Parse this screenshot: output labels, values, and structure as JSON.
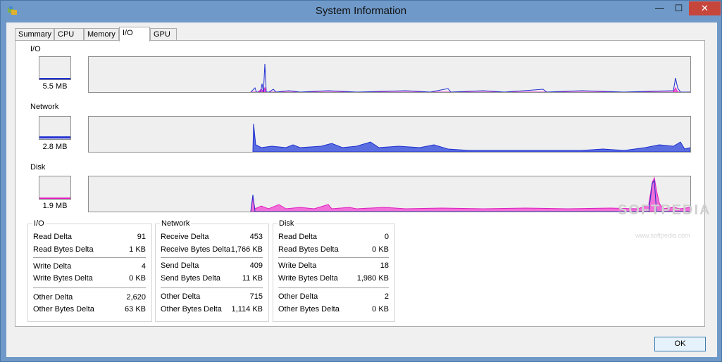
{
  "window": {
    "title": "System Information"
  },
  "controls": {
    "minimize": "—",
    "maximize": "☐",
    "close": "✕"
  },
  "tabs": [
    {
      "label": "Summary"
    },
    {
      "label": "CPU"
    },
    {
      "label": "Memory"
    },
    {
      "label": "I/O",
      "active": true
    },
    {
      "label": "GPU"
    }
  ],
  "graphs": {
    "io": {
      "label": "I/O",
      "value": "5.5  MB"
    },
    "network": {
      "label": "Network",
      "value": "2.8  MB"
    },
    "disk": {
      "label": "Disk",
      "value": "1.9  MB"
    }
  },
  "colors": {
    "blue": "#1f2fd0",
    "fill_blue": "#5a6ee0",
    "pink": "#e020c0",
    "fill_pink": "#f070d8"
  },
  "groups": {
    "io": {
      "title": "I/O",
      "rows": [
        {
          "label": "Read Delta",
          "value": "91"
        },
        {
          "label": "Read Bytes Delta",
          "value": "1 KB"
        },
        {
          "label": "Write Delta",
          "value": "4"
        },
        {
          "label": "Write Bytes Delta",
          "value": "0 KB"
        },
        {
          "label": "Other Delta",
          "value": "2,620"
        },
        {
          "label": "Other Bytes Delta",
          "value": "63 KB"
        }
      ]
    },
    "network": {
      "title": "Network",
      "rows": [
        {
          "label": "Receive Delta",
          "value": "453"
        },
        {
          "label": "Receive Bytes Delta",
          "value": "1,766 KB"
        },
        {
          "label": "Send Delta",
          "value": "409"
        },
        {
          "label": "Send Bytes Delta",
          "value": "11 KB"
        },
        {
          "label": "Other Delta",
          "value": "715"
        },
        {
          "label": "Other Bytes Delta",
          "value": "1,114 KB"
        }
      ]
    },
    "disk": {
      "title": "Disk",
      "rows": [
        {
          "label": "Read Delta",
          "value": "0"
        },
        {
          "label": "Read Bytes Delta",
          "value": "0 KB"
        },
        {
          "label": "Write Delta",
          "value": "18"
        },
        {
          "label": "Write Bytes Delta",
          "value": "1,980 KB"
        },
        {
          "label": "Other Delta",
          "value": "2"
        },
        {
          "label": "Other Bytes Delta",
          "value": "0 KB"
        }
      ]
    }
  },
  "watermark": {
    "text": "SOFTPEDIA",
    "sub": "www.softpedia.com"
  },
  "buttons": {
    "ok": "OK"
  }
}
